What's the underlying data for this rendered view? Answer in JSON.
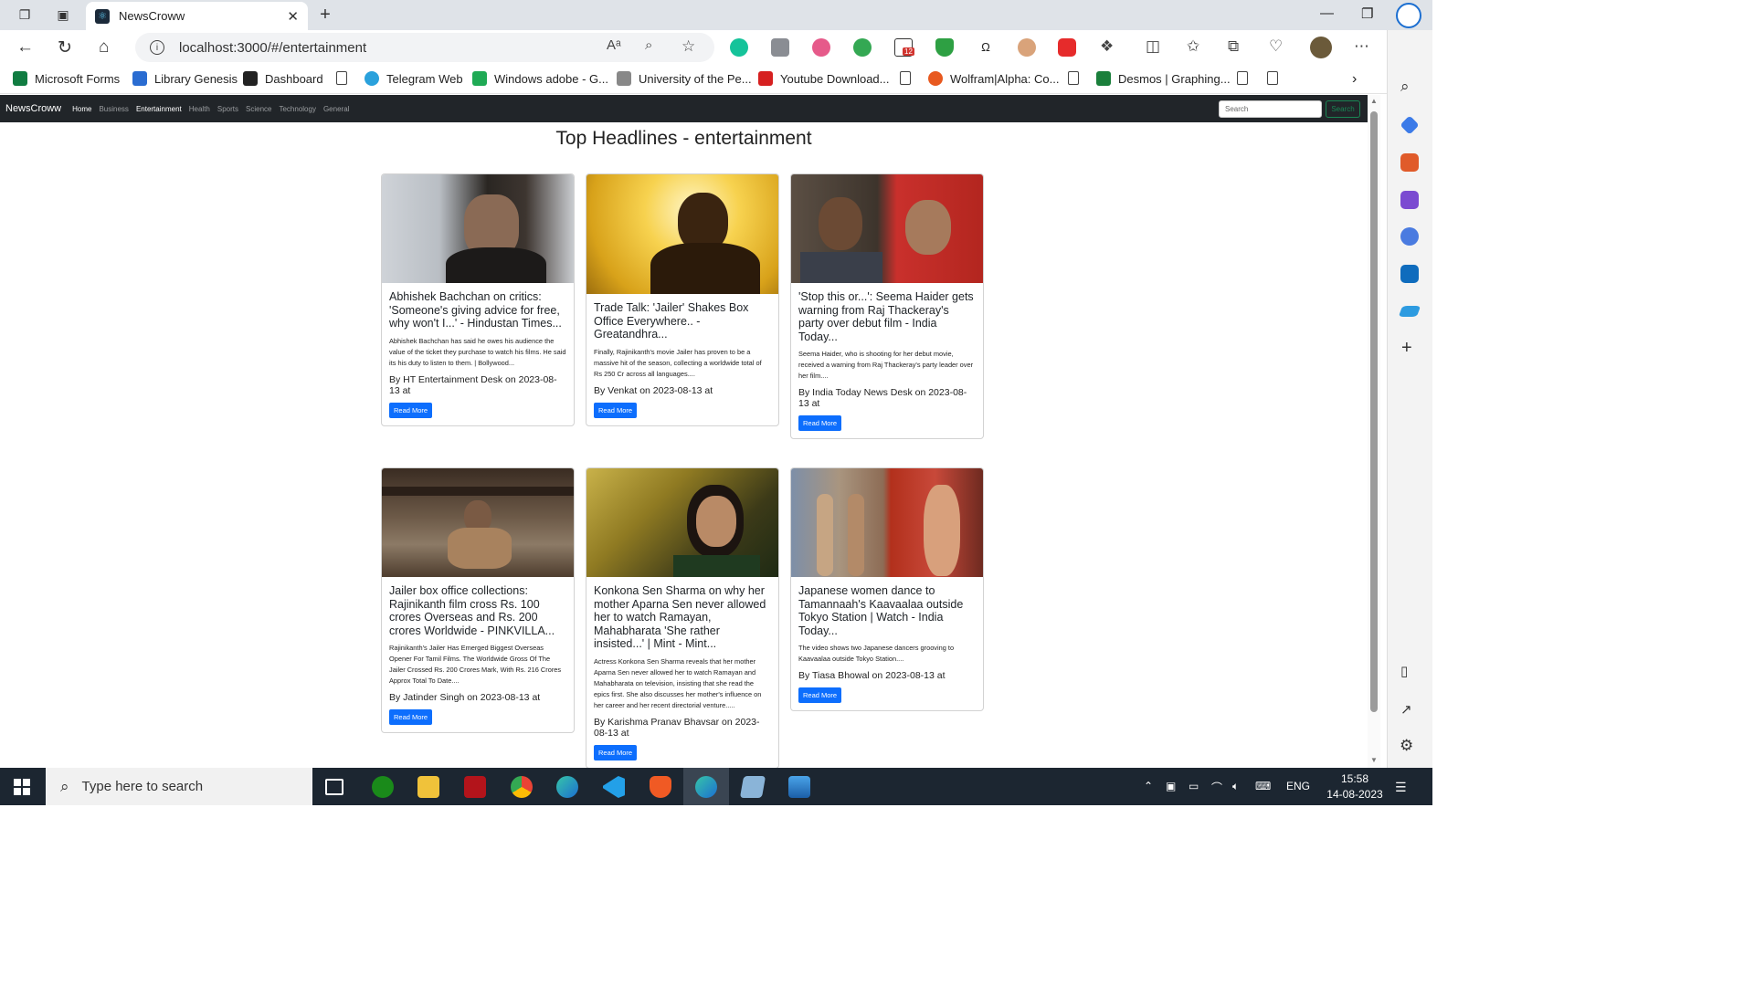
{
  "browser": {
    "tab_title": "NewsCroww",
    "url": "localhost:3000/#/entertainment",
    "extension_badge": "12",
    "bookmarks": [
      {
        "label": "Microsoft Forms",
        "color": "#107c41"
      },
      {
        "label": "Library Genesis",
        "color": "#2a6cd1"
      },
      {
        "label": "Dashboard",
        "color": "#222222"
      },
      {
        "label": "",
        "color": ""
      },
      {
        "label": "Telegram Web",
        "color": "#2aa1dc"
      },
      {
        "label": "Windows adobe - G...",
        "color": "#1faa55"
      },
      {
        "label": "University of the Pe...",
        "color": "#888888"
      },
      {
        "label": "Youtube Download...",
        "color": "#d62020"
      },
      {
        "label": "",
        "color": ""
      },
      {
        "label": "Wolfram|Alpha: Co...",
        "color": "#e8591f"
      },
      {
        "label": "",
        "color": ""
      },
      {
        "label": "Desmos | Graphing...",
        "color": "#1a7f3b"
      },
      {
        "label": "",
        "color": ""
      },
      {
        "label": "",
        "color": ""
      }
    ]
  },
  "app": {
    "brand": "NewsCroww",
    "nav": [
      "Home",
      "Business",
      "Entertainment",
      "Health",
      "Sports",
      "Science",
      "Technology",
      "General"
    ],
    "search_placeholder": "Search",
    "search_button": "Search",
    "page_title": "Top Headlines - entertainment",
    "read_more": "Read More"
  },
  "articles": [
    {
      "title": "Abhishek Bachchan on critics: 'Someone's giving advice for free, why won't I...' - Hindustan Times...",
      "description": "Abhishek Bachchan has said he owes his audience the value of the ticket they purchase to watch his films. He said its his duty to listen to them. | Bollywood...",
      "meta": "By HT Entertainment Desk on 2023-08-13 at"
    },
    {
      "title": "Trade Talk: 'Jailer' Shakes Box Office Everywhere.. - Greatandhra...",
      "description": "Finally, Rajinikanth's movie Jailer has proven to be a massive hit of the season, collecting a worldwide total of Rs 250 Cr across all languages....",
      "meta": "By Venkat on 2023-08-13 at"
    },
    {
      "title": "'Stop this or...': Seema Haider gets warning from Raj Thackeray's party over debut film - India Today...",
      "description": "Seema Haider, who is shooting for her debut movie, received a warning from Raj Thackeray's party leader over her film....",
      "meta": "By India Today News Desk on 2023-08-13 at"
    },
    {
      "title": "Jailer box office collections: Rajinikanth film cross Rs. 100 crores Overseas and Rs. 200 crores Worldwide - PINKVILLA...",
      "description": "Rajinikanth's Jailer Has Emerged Biggest Overseas Opener For Tamil Films. The Worldwide Gross Of The Jailer Crossed Rs. 200 Crores Mark, With Rs. 216 Crores Approx Total To Date....",
      "meta": "By Jatinder Singh on 2023-08-13 at"
    },
    {
      "title": "Konkona Sen Sharma on why her mother Aparna Sen never allowed her to watch Ramayan, Mahabharata 'She rather insisted...' | Mint - Mint...",
      "description": "Actress Konkona Sen Sharma reveals that her mother Aparna Sen never allowed her to watch Ramayan and Mahabharata on television, insisting that she read the epics first. She also discusses her mother's influence on her career and her recent directorial venture.....",
      "meta": "By Karishma Pranav Bhavsar on 2023-08-13 at"
    },
    {
      "title": "Japanese women dance to Tamannaah's Kaavaalaa outside Tokyo Station | Watch - India Today...",
      "description": "The video shows two Japanese dancers grooving to Kaavaalaa outside Tokyo Station....",
      "meta": "By Tiasa Bhowal on 2023-08-13 at"
    }
  ],
  "taskbar": {
    "search_placeholder": "Type here to search",
    "language": "ENG",
    "time": "15:58",
    "date": "14-08-2023"
  }
}
